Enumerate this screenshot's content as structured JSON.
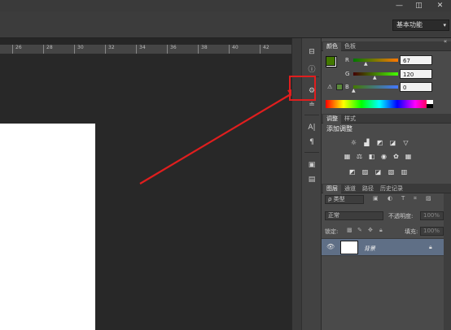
{
  "window": {
    "controls": [
      "—",
      "◫",
      "✕"
    ]
  },
  "options_bar": {
    "workspace": "基本功能"
  },
  "ruler": {
    "ticks": [
      "26",
      "28",
      "30",
      "32",
      "34",
      "36",
      "38",
      "40",
      "42"
    ]
  },
  "color_panel": {
    "tabs": [
      "颜色",
      "色板"
    ],
    "channels": [
      {
        "label": "R",
        "value": "67"
      },
      {
        "label": "G",
        "value": "120"
      },
      {
        "label": "B",
        "value": "0"
      }
    ],
    "foreground_color": "#437800"
  },
  "adjustments_panel": {
    "tabs": [
      "调整",
      "样式"
    ],
    "title": "添加调整"
  },
  "layers_panel": {
    "tabs": [
      "图层",
      "通道",
      "路径",
      "历史记录"
    ],
    "filter_kind": "ρ 类型",
    "blend_mode": "正常",
    "opacity_label": "不透明度:",
    "opacity_value": "100%",
    "lock_label": "锁定:",
    "fill_label": "填充:",
    "fill_value": "100%",
    "layers": [
      {
        "name": "背景",
        "visible": true,
        "locked": true
      }
    ]
  },
  "annotation": {
    "color": "#e01e1e"
  }
}
